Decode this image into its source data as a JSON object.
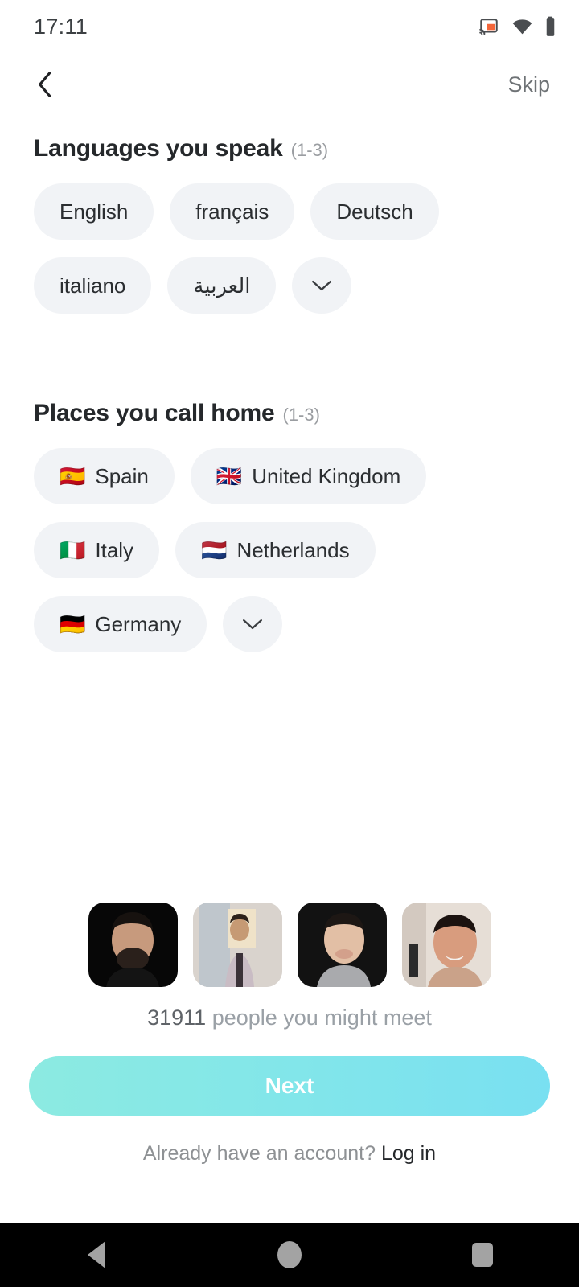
{
  "status_bar": {
    "time": "17:11",
    "icons": [
      "cast-icon",
      "wifi-icon",
      "battery-icon"
    ],
    "cast_color": "#f4663a"
  },
  "top_bar": {
    "back_icon": "chevron-left-icon",
    "skip_label": "Skip"
  },
  "languages_section": {
    "title": "Languages you speak",
    "count_hint": "(1-3)",
    "chips": [
      {
        "label": "English"
      },
      {
        "label": "français"
      },
      {
        "label": "Deutsch"
      },
      {
        "label": "italiano"
      },
      {
        "label": "العربية"
      }
    ],
    "expand_icon": "chevron-down-icon"
  },
  "places_section": {
    "title": "Places you call home",
    "count_hint": "(1-3)",
    "chips": [
      {
        "flag": "🇪🇸",
        "label": "Spain"
      },
      {
        "flag": "🇬🇧",
        "label": "United Kingdom"
      },
      {
        "flag": "🇮🇹",
        "label": "Italy"
      },
      {
        "flag": "🇳🇱",
        "label": "Netherlands"
      },
      {
        "flag": "🇩🇪",
        "label": "Germany"
      }
    ],
    "expand_icon": "chevron-down-icon"
  },
  "social_proof": {
    "avatars": [
      {
        "name": "avatar-1"
      },
      {
        "name": "avatar-2"
      },
      {
        "name": "avatar-3"
      },
      {
        "name": "avatar-4"
      }
    ],
    "count": "31911",
    "caption": "people you might meet"
  },
  "footer": {
    "next_label": "Next",
    "next_gradient_from": "#8ceae1",
    "next_gradient_to": "#79e0f1",
    "login_prompt": "Already have an account? ",
    "login_link": "Log in"
  },
  "nav_bar": {
    "back": "back-triangle-icon",
    "home": "home-circle-icon",
    "recents": "recents-square-icon"
  }
}
